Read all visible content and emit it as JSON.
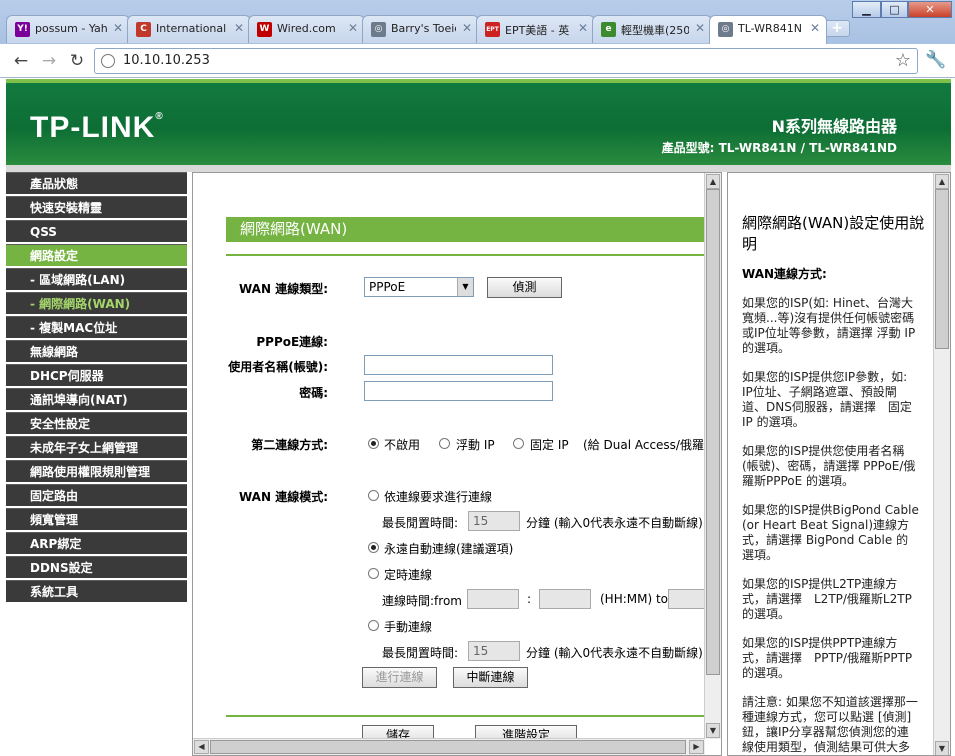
{
  "browser": {
    "tabs": [
      {
        "title": "possum - Yaho",
        "favicon": "yahoo-icon",
        "color": "#7b0099",
        "glyph": "Y!"
      },
      {
        "title": "International N",
        "favicon": "ih-icon",
        "color": "#c0392b",
        "glyph": "C"
      },
      {
        "title": "Wired.com",
        "favicon": "wired-icon",
        "color": "#c00000",
        "glyph": "W"
      },
      {
        "title": "Barry's Toeic T",
        "favicon": "globe-icon",
        "color": "#6d7b8d",
        "glyph": "◎"
      },
      {
        "title": "EPT美語 - 英",
        "favicon": "ept-icon",
        "color": "#cc2222",
        "glyph": "EPT"
      },
      {
        "title": "輕型機車(250",
        "favicon": "green-icon",
        "color": "#3d8b2f",
        "glyph": "e"
      },
      {
        "title": "TL-WR841N",
        "favicon": "globe-icon",
        "color": "#6d7b8d",
        "glyph": "◎",
        "active": true
      }
    ],
    "url": "10.10.10.253",
    "newtab_symbol": "+",
    "window_buttons": [
      "▁",
      "□",
      "✕"
    ]
  },
  "banner": {
    "logo": "TP-LINK",
    "product_name": "N系列無線路由器",
    "model_label": "產品型號: TL-WR841N / TL-WR841ND",
    "brand_color": "#0d6e35",
    "accent_color": "#75b342"
  },
  "menu": [
    {
      "label": "產品狀態"
    },
    {
      "label": "快速安裝精靈"
    },
    {
      "label": "QSS"
    },
    {
      "label": "網路設定",
      "active": true
    },
    {
      "label": "- 區域網路(LAN)",
      "sub": true
    },
    {
      "label": "- 網際網路(WAN)",
      "sub": true,
      "current": true
    },
    {
      "label": "- 複製MAC位址",
      "sub": true
    },
    {
      "label": "無線網路"
    },
    {
      "label": "DHCP伺服器"
    },
    {
      "label": "通訊埠導向(NAT)"
    },
    {
      "label": "安全性設定"
    },
    {
      "label": "未成年子女上網管理"
    },
    {
      "label": "網路使用權限規則管理"
    },
    {
      "label": "固定路由"
    },
    {
      "label": "頻寬管理"
    },
    {
      "label": "ARP綁定"
    },
    {
      "label": "DDNS設定"
    },
    {
      "label": "系統工具"
    }
  ],
  "form": {
    "section_title": "網際網路(WAN)",
    "wan_type_label": "WAN 連線類型:",
    "wan_type_value": "PPPoE",
    "detect_button": "偵測",
    "pppoe_label": "PPPoE連線:",
    "username_label": "使用者名稱(帳號):",
    "username_value": "",
    "password_label": "密碼:",
    "password_value": "",
    "secondary_label": "第二連線方式:",
    "secondary_options": [
      "不啟用",
      "浮動 IP",
      "固定 IP"
    ],
    "secondary_note": "(給 Dual Access/俄羅斯",
    "mode_label": "WAN 連線模式:",
    "mode_on_demand": "依連線要求進行連線",
    "max_idle_label": "最長閒置時間:",
    "max_idle_value_1": "15",
    "max_idle_note": "分鐘 (輸入0代表永遠不自動斷線)",
    "mode_auto": "永遠自動連線(建議選項)",
    "mode_timed": "定時連線",
    "period_label": "連線時間:from",
    "time_colon": ":",
    "time_format": "(HH:MM) to",
    "mode_manual": "手動連線",
    "max_idle_value_2": "15",
    "connect_button": "進行連線",
    "disconnect_button": "中斷連線",
    "save_button": "儲存",
    "advanced_button": "進階設定"
  },
  "help": {
    "title": "網際網路(WAN)設定使用說明",
    "subtitle": "WAN連線方式:",
    "paragraphs": [
      "如果您的ISP(如: Hinet、台灣大寬頻...等)沒有提供任何帳號密碼或IP位址等參數，請選擇 浮動 IP 的選項。",
      "如果您的ISP提供您IP參數，如: IP位址、子網路遮罩、預設閘道、DNS伺服器，請選擇　固定 IP 的選項。",
      "如果您的ISP提供您使用者名稱(帳號)、密碼，請選擇 PPPoE/俄羅斯PPPoE 的選項。",
      "如果您的ISP提供BigPond Cable (or Heart Beat Signal)連線方式，請選擇 BigPond Cable 的選項。",
      "如果您的ISP提供L2TP連線方式，請選擇　L2TP/俄羅斯L2TP 的選項。",
      "如果您的ISP提供PPTP連線方式，請選擇　PPTP/俄羅斯PPTP 的選項。",
      "請注意: 如果您不知道該選擇那一種連線方式，您可以點選 [偵測] 鈕，讓IP分享器幫您偵測您的連線使用類型，偵測結果可供大多數情況參考，但實際使用連線"
    ]
  }
}
